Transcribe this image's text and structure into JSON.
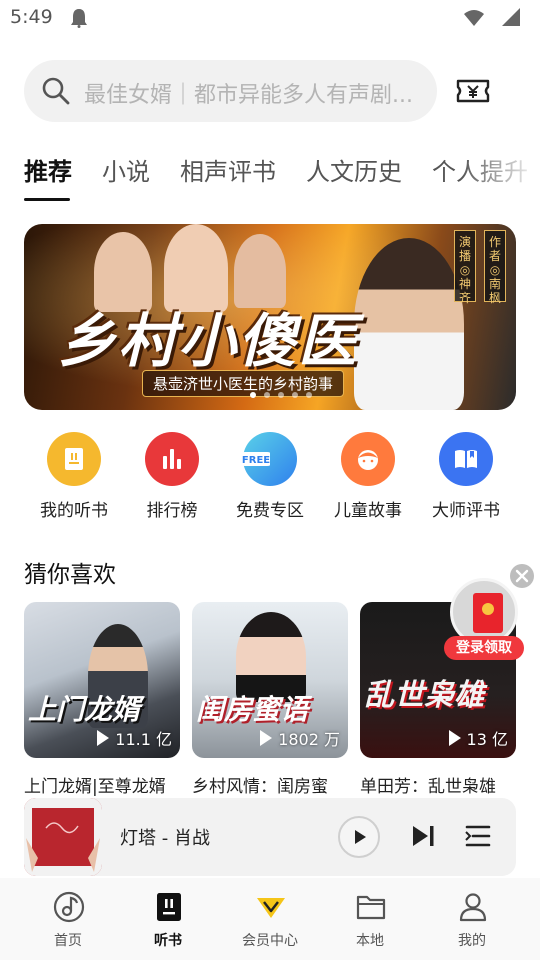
{
  "status_bar": {
    "time": "5:49"
  },
  "search": {
    "placeholder": "最佳女婿｜都市异能多人有声剧..."
  },
  "tabs": [
    {
      "label": "推荐",
      "active": true
    },
    {
      "label": "小说"
    },
    {
      "label": "相声评书"
    },
    {
      "label": "人文历史"
    },
    {
      "label": "个人提升"
    }
  ],
  "banner": {
    "title": "乡村小傻医",
    "subtitle": "悬壶济世小医生的乡村韵事",
    "tag_cast": "演播◎神齐",
    "tag_author": "作者◎南枫"
  },
  "entries": [
    {
      "label": "我的听书",
      "icon": "book-icon",
      "color": "#f5b82e"
    },
    {
      "label": "排行榜",
      "icon": "bar-chart-icon",
      "color": "#e8383a"
    },
    {
      "label": "免费专区",
      "icon": "free-badge-icon",
      "icon_text": "FREE",
      "color": "#2f80ed"
    },
    {
      "label": "儿童故事",
      "icon": "kid-face-icon",
      "color": "#ff7a3d"
    },
    {
      "label": "大师评书",
      "icon": "open-book-icon",
      "color": "#3b74f2"
    }
  ],
  "section": {
    "title": "猜你喜欢"
  },
  "cards": [
    {
      "title": "上门龙婿|至尊龙婿",
      "cover_text": "上门龙婿",
      "plays": "11.1 亿"
    },
    {
      "title": "乡村风情：闺房蜜",
      "cover_text": "闺房蜜语",
      "plays": "1802 万"
    },
    {
      "title": "单田芳：乱世枭雄",
      "cover_text": "乱世枭雄",
      "plays": "13 亿"
    }
  ],
  "promo": {
    "label": "登录领取"
  },
  "player": {
    "title": "灯塔 - 肖战"
  },
  "nav": [
    {
      "label": "首页",
      "icon": "music-disc-icon"
    },
    {
      "label": "听书",
      "icon": "audiobook-icon",
      "active": true
    },
    {
      "label": "会员中心",
      "icon": "vip-diamond-icon"
    },
    {
      "label": "本地",
      "icon": "folder-icon"
    },
    {
      "label": "我的",
      "icon": "person-icon"
    }
  ],
  "colors": {
    "accent": "#111111",
    "vip": "#f5c518",
    "promo": "#f0383d"
  }
}
